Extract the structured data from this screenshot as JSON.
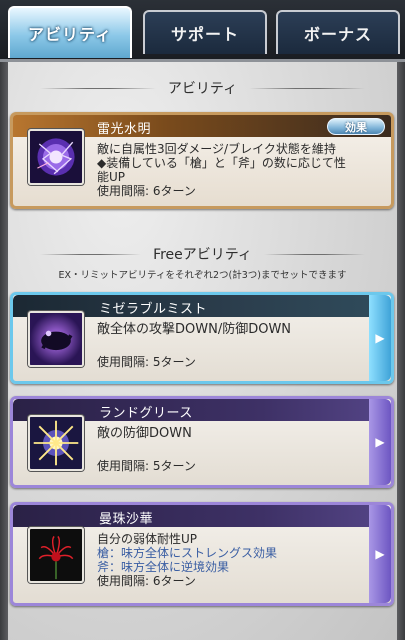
{
  "tabs": [
    {
      "label": "アビリティ",
      "active": true
    },
    {
      "label": "サポート",
      "active": false
    },
    {
      "label": "ボーナス",
      "active": false
    }
  ],
  "ability_section": {
    "title": "アビリティ",
    "main": {
      "name": "雷光水明",
      "effect_button": "効果",
      "desc": [
        "敵に自属性3回ダメージ/ブレイク状態を維持",
        "◆装備している「槍」と「斧」の数に応じて性",
        "能UP"
      ],
      "cooldown": "使用間隔: 6ターン",
      "icon": "lightning-orb-icon"
    }
  },
  "free_section": {
    "title": "Freeアビリティ",
    "note": "EX・リミットアビリティをそれぞれ2つ(計3つ)までセットできます",
    "items": [
      {
        "name": "ミゼラブルミスト",
        "desc": "敵全体の攻撃DOWN/防御DOWN",
        "cooldown": "使用間隔: 5ターン",
        "icon": "mist-icon",
        "arrow": "▶"
      },
      {
        "name": "ランドグリース",
        "desc": "敵の防御DOWN",
        "cooldown": "使用間隔: 5ターン",
        "icon": "sparkle-burst-icon",
        "arrow": "▶"
      },
      {
        "name": "曼珠沙華",
        "desc": "自分の弱体耐性UP",
        "sub1": "槍：味方全体にストレングス効果",
        "sub2": "斧：味方全体に逆境効果",
        "cooldown": "使用間隔: 6ターン",
        "icon": "red-spider-lily-icon",
        "arrow": "▶"
      }
    ]
  },
  "colors": {
    "main_border": "#c79a5e",
    "cyan_border": "#6cc8ec",
    "purple_border": "#9c86d9",
    "sub_text": "#3a5ea3"
  }
}
